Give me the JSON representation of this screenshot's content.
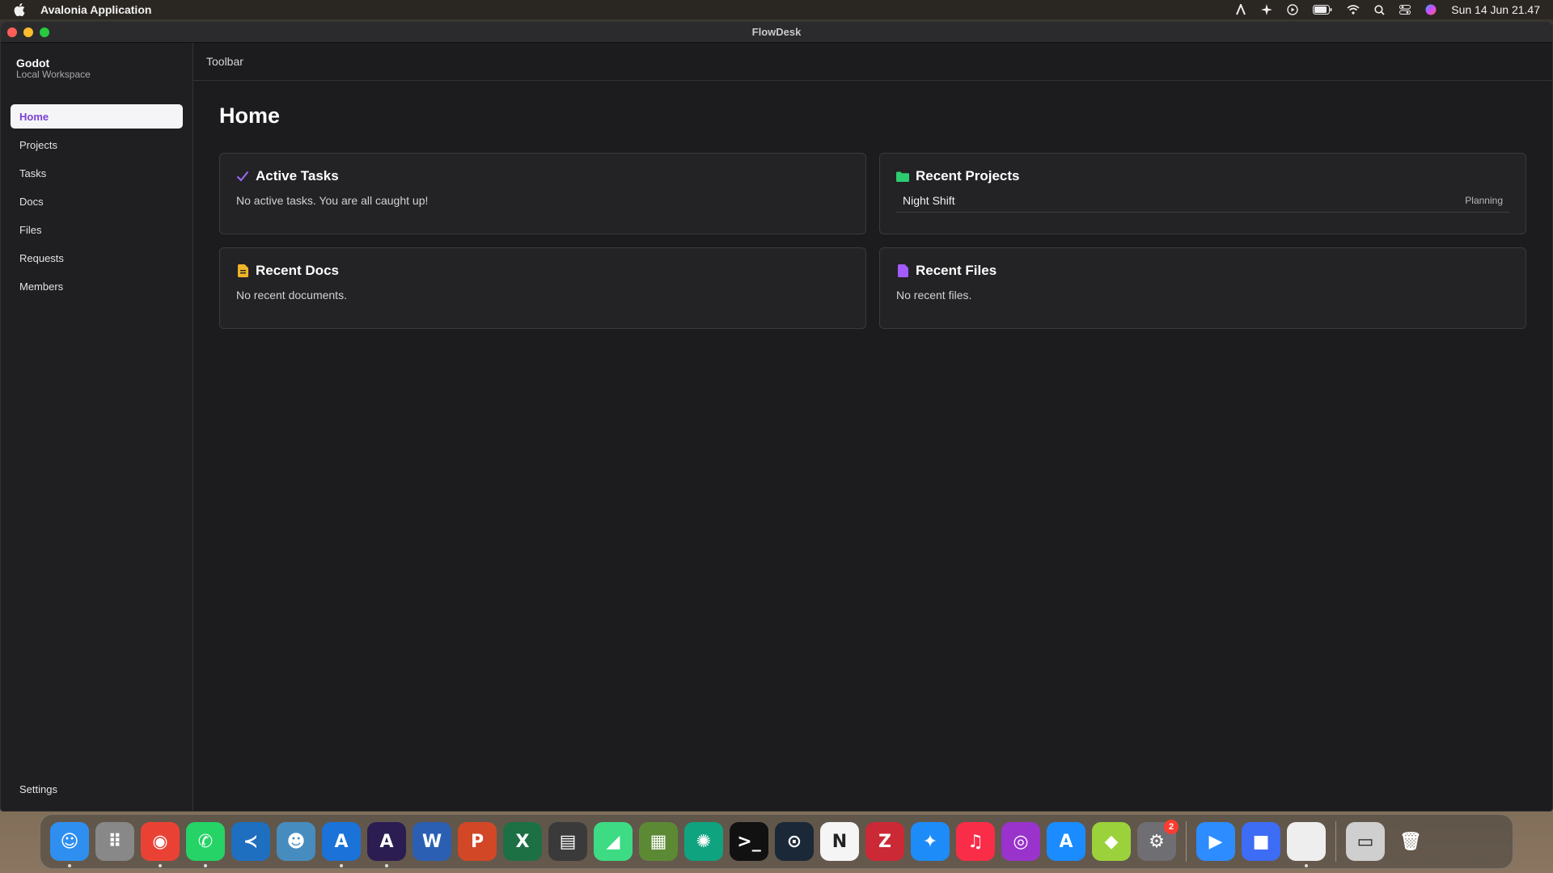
{
  "menubar": {
    "app_name": "Avalonia Application",
    "clock": "Sun 14 Jun  21.47",
    "status_icons": [
      "text-input-icon",
      "sparkle-icon",
      "play-circle-icon",
      "battery-icon",
      "wifi-icon",
      "search-icon",
      "control-center-icon",
      "siri-icon"
    ]
  },
  "window": {
    "title": "FlowDesk",
    "workspace": {
      "name": "Godot",
      "subtitle": "Local Workspace"
    },
    "nav": [
      {
        "label": "Home",
        "active": true
      },
      {
        "label": "Projects"
      },
      {
        "label": "Tasks"
      },
      {
        "label": "Docs"
      },
      {
        "label": "Files"
      },
      {
        "label": "Requests"
      },
      {
        "label": "Members"
      }
    ],
    "settings_label": "Settings",
    "toolbar_label": "Toolbar",
    "page_title": "Home",
    "cards": {
      "active_tasks": {
        "title": "Active Tasks",
        "empty": "No active tasks. You are all caught up!",
        "icon": "check-icon",
        "color": "#9b6bff"
      },
      "recent_projects": {
        "title": "Recent Projects",
        "icon": "folder-icon",
        "color": "#2ecc71",
        "items": [
          {
            "name": "Night Shift",
            "status": "Planning"
          }
        ]
      },
      "recent_docs": {
        "title": "Recent Docs",
        "empty": "No recent documents.",
        "icon": "document-icon",
        "color": "#f0b429"
      },
      "recent_files": {
        "title": "Recent Files",
        "empty": "No recent files.",
        "icon": "file-icon",
        "color": "#a35bff"
      }
    },
    "accent_color": "#7b3fd6"
  },
  "dock": {
    "apps": [
      {
        "name": "finder-icon",
        "glyph": "☺",
        "bg": "#2f8ff0",
        "running": true
      },
      {
        "name": "launchpad-icon",
        "glyph": "⠿",
        "bg": "#888888",
        "running": false
      },
      {
        "name": "chrome-icon",
        "glyph": "◉",
        "bg": "#e94235",
        "running": true
      },
      {
        "name": "whatsapp-icon",
        "glyph": "✆",
        "bg": "#25d366",
        "running": true
      },
      {
        "name": "vscode-icon",
        "glyph": "≺",
        "bg": "#1e6fbf",
        "running": false
      },
      {
        "name": "godot-icon",
        "glyph": "☻",
        "bg": "#478cbf",
        "running": false
      },
      {
        "name": "affinity-designer-icon",
        "glyph": "A",
        "bg": "#1b72d8",
        "running": true
      },
      {
        "name": "affinity-photo-icon",
        "glyph": "A",
        "bg": "#2b1d52",
        "running": true
      },
      {
        "name": "word-icon",
        "glyph": "W",
        "bg": "#2b5fb3",
        "running": false
      },
      {
        "name": "powerpoint-icon",
        "glyph": "P",
        "bg": "#d24726",
        "running": false
      },
      {
        "name": "excel-icon",
        "glyph": "X",
        "bg": "#1d7044",
        "running": false
      },
      {
        "name": "final-cut-icon",
        "glyph": "▤",
        "bg": "#3a3a3a",
        "running": false
      },
      {
        "name": "android-studio-icon",
        "glyph": "◢",
        "bg": "#3ddc84",
        "running": false
      },
      {
        "name": "minecraft-icon",
        "glyph": "▦",
        "bg": "#5c8a34",
        "running": false
      },
      {
        "name": "chatgpt-icon",
        "glyph": "✺",
        "bg": "#10a37f",
        "running": false
      },
      {
        "name": "terminal-icon",
        "glyph": ">_",
        "bg": "#111111",
        "running": false
      },
      {
        "name": "steam-icon",
        "glyph": "⊙",
        "bg": "#1b2838",
        "running": false
      },
      {
        "name": "notion-icon",
        "glyph": "N",
        "bg": "#f5f5f5",
        "running": false
      },
      {
        "name": "zotero-icon",
        "glyph": "Z",
        "bg": "#cc2936",
        "running": false
      },
      {
        "name": "safari-icon",
        "glyph": "✦",
        "bg": "#1d8cf8",
        "running": false
      },
      {
        "name": "music-icon",
        "glyph": "♫",
        "bg": "#fa2d48",
        "running": false
      },
      {
        "name": "podcasts-icon",
        "glyph": "◎",
        "bg": "#9933cc",
        "running": false
      },
      {
        "name": "app-store-icon",
        "glyph": "A",
        "bg": "#1a8cff",
        "running": false
      },
      {
        "name": "cube-app-icon",
        "glyph": "◆",
        "bg": "#9bd13b",
        "running": false
      },
      {
        "name": "system-settings-icon",
        "glyph": "⚙",
        "bg": "#6e6e73",
        "running": false,
        "badge": "2"
      }
    ],
    "recent": [
      {
        "name": "zoom-icon",
        "glyph": "▶",
        "bg": "#2d8cff",
        "running": false
      },
      {
        "name": "roblox-icon",
        "glyph": "■",
        "bg": "#3d6cf5",
        "running": false
      },
      {
        "name": "document-file-icon",
        "glyph": "",
        "bg": "#eeeeee",
        "running": true
      }
    ],
    "trailing": [
      {
        "name": "downloads-stack-icon",
        "glyph": "▭",
        "bg": "#cfcfcf",
        "running": false
      },
      {
        "name": "trash-icon",
        "glyph": "🗑",
        "bg": "transparent",
        "running": false
      }
    ]
  }
}
